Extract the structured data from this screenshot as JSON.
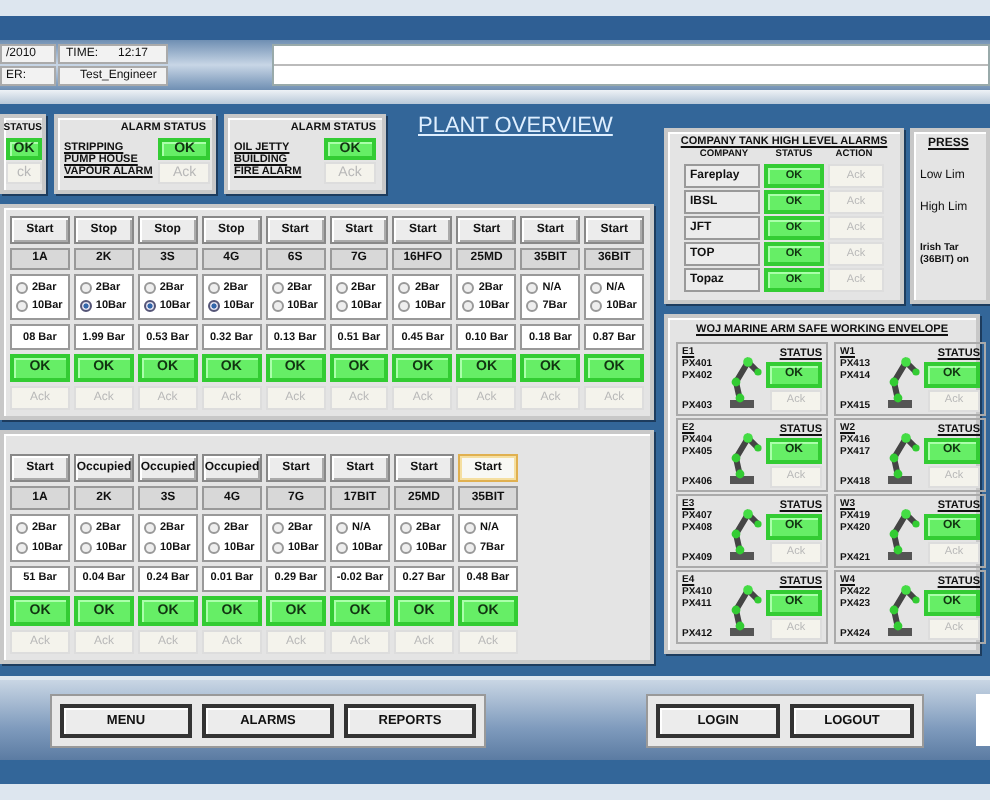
{
  "header": {
    "date": "/2010",
    "time_label": "TIME:",
    "time": "12:17",
    "user_label": "ER:",
    "user": "Test_Engineer"
  },
  "alarms": [
    {
      "heading": "STATUS",
      "status": "OK",
      "ack": "ck"
    },
    {
      "heading": "ALARM STATUS",
      "lines": [
        "STRIPPING",
        "PUMP HOUSE",
        "VAPOUR  ALARM"
      ],
      "status": "OK",
      "ack": "Ack"
    },
    {
      "heading": "ALARM STATUS",
      "lines": [
        "OIL JETTY",
        "BUILDING",
        "FIRE ALARM"
      ],
      "status": "OK",
      "ack": "Ack"
    }
  ],
  "title": "PLANT OVERVIEW",
  "pump_groups": [
    {
      "columns": [
        {
          "button": "Start",
          "focused": false,
          "name": "1A",
          "options": [
            {
              "label": "2Bar",
              "selected": false
            },
            {
              "label": "10Bar",
              "selected": false
            }
          ],
          "reading": "08 Bar",
          "status": "OK",
          "ack": "Ack"
        },
        {
          "button": "Stop",
          "focused": false,
          "name": "2K",
          "options": [
            {
              "label": "2Bar",
              "selected": false
            },
            {
              "label": "10Bar",
              "selected": true
            }
          ],
          "reading": "1.99 Bar",
          "status": "OK",
          "ack": "Ack"
        },
        {
          "button": "Stop",
          "focused": false,
          "name": "3S",
          "options": [
            {
              "label": "2Bar",
              "selected": false
            },
            {
              "label": "10Bar",
              "selected": true
            }
          ],
          "reading": "0.53 Bar",
          "status": "OK",
          "ack": "Ack"
        },
        {
          "button": "Stop",
          "focused": false,
          "name": "4G",
          "options": [
            {
              "label": "2Bar",
              "selected": false
            },
            {
              "label": "10Bar",
              "selected": true
            }
          ],
          "reading": "0.32 Bar",
          "status": "OK",
          "ack": "Ack"
        },
        {
          "button": "Start",
          "focused": false,
          "name": "6S",
          "options": [
            {
              "label": "2Bar",
              "selected": false
            },
            {
              "label": "10Bar",
              "selected": false
            }
          ],
          "reading": "0.13 Bar",
          "status": "OK",
          "ack": "Ack"
        },
        {
          "button": "Start",
          "focused": false,
          "name": "7G",
          "options": [
            {
              "label": "2Bar",
              "selected": false
            },
            {
              "label": "10Bar",
              "selected": false
            }
          ],
          "reading": "0.51 Bar",
          "status": "OK",
          "ack": "Ack"
        },
        {
          "button": "Start",
          "focused": false,
          "name": "16HFO",
          "options": [
            {
              "label": "2Bar",
              "selected": false
            },
            {
              "label": "10Bar",
              "selected": false
            }
          ],
          "reading": "0.45 Bar",
          "status": "OK",
          "ack": "Ack"
        },
        {
          "button": "Start",
          "focused": false,
          "name": "25MD",
          "options": [
            {
              "label": "2Bar",
              "selected": false
            },
            {
              "label": "10Bar",
              "selected": false
            }
          ],
          "reading": "0.10 Bar",
          "status": "OK",
          "ack": "Ack"
        },
        {
          "button": "Start",
          "focused": false,
          "name": "35BIT",
          "options": [
            {
              "label": "N/A",
              "selected": false
            },
            {
              "label": "7Bar",
              "selected": false
            }
          ],
          "reading": "0.18 Bar",
          "status": "OK",
          "ack": "Ack"
        },
        {
          "button": "Start",
          "focused": false,
          "name": "36BIT",
          "options": [
            {
              "label": "N/A",
              "selected": false
            },
            {
              "label": "10Bar",
              "selected": false
            }
          ],
          "reading": "0.87 Bar",
          "status": "OK",
          "ack": "Ack"
        }
      ]
    },
    {
      "columns": [
        {
          "button": "Start",
          "focused": false,
          "name": "1A",
          "options": [
            {
              "label": "2Bar",
              "selected": false
            },
            {
              "label": "10Bar",
              "selected": false
            }
          ],
          "reading": "51 Bar",
          "status": "OK",
          "ack": "Ack"
        },
        {
          "button": "Occupied",
          "focused": false,
          "name": "2K",
          "options": [
            {
              "label": "2Bar",
              "selected": false
            },
            {
              "label": "10Bar",
              "selected": false
            }
          ],
          "reading": "0.04 Bar",
          "status": "OK",
          "ack": "Ack"
        },
        {
          "button": "Occupied",
          "focused": false,
          "name": "3S",
          "options": [
            {
              "label": "2Bar",
              "selected": false
            },
            {
              "label": "10Bar",
              "selected": false
            }
          ],
          "reading": "0.24 Bar",
          "status": "OK",
          "ack": "Ack"
        },
        {
          "button": "Occupied",
          "focused": false,
          "name": "4G",
          "options": [
            {
              "label": "2Bar",
              "selected": false
            },
            {
              "label": "10Bar",
              "selected": false
            }
          ],
          "reading": "0.01 Bar",
          "status": "OK",
          "ack": "Ack"
        },
        {
          "button": "Start",
          "focused": false,
          "name": "7G",
          "options": [
            {
              "label": "2Bar",
              "selected": false
            },
            {
              "label": "10Bar",
              "selected": false
            }
          ],
          "reading": "0.29 Bar",
          "status": "OK",
          "ack": "Ack"
        },
        {
          "button": "Start",
          "focused": false,
          "name": "17BIT",
          "options": [
            {
              "label": "N/A",
              "selected": false
            },
            {
              "label": "10Bar",
              "selected": false
            }
          ],
          "reading": "-0.02 Bar",
          "status": "OK",
          "ack": "Ack"
        },
        {
          "button": "Start",
          "focused": false,
          "name": "25MD",
          "options": [
            {
              "label": "2Bar",
              "selected": false
            },
            {
              "label": "10Bar",
              "selected": false
            }
          ],
          "reading": "0.27 Bar",
          "status": "OK",
          "ack": "Ack"
        },
        {
          "button": "Start",
          "focused": true,
          "name": "35BIT",
          "options": [
            {
              "label": "N/A",
              "selected": false
            },
            {
              "label": "7Bar",
              "selected": false
            }
          ],
          "reading": "0.48 Bar",
          "status": "OK",
          "ack": "Ack"
        }
      ]
    }
  ],
  "tank_alarms": {
    "title": "COMPANY TANK HIGH LEVEL ALARMS",
    "columns": [
      "COMPANY",
      "STATUS",
      "ACTION"
    ],
    "rows": [
      {
        "company": "Fareplay",
        "status": "OK",
        "action": "Ack"
      },
      {
        "company": "IBSL",
        "status": "OK",
        "action": "Ack"
      },
      {
        "company": "JFT",
        "status": "OK",
        "action": "Ack"
      },
      {
        "company": "TOP",
        "status": "OK",
        "action": "Ack"
      },
      {
        "company": "Topaz",
        "status": "OK",
        "action": "Ack"
      }
    ]
  },
  "pressure": {
    "title": "PRESS",
    "low": "Low Lim",
    "high": "High Lim",
    "note": [
      "Irish Tar",
      "(36BIT) on"
    ]
  },
  "marine_arms": {
    "title": "WOJ MARINE ARM SAFE WORKING ENVELOPE",
    "arms": [
      {
        "name": "E1",
        "sensors": [
          "PX401",
          "PX402",
          "PX403"
        ],
        "status_label": "STATUS",
        "status": "OK",
        "ack": "Ack"
      },
      {
        "name": "W1",
        "sensors": [
          "PX413",
          "PX414",
          "PX415"
        ],
        "status_label": "STATUS",
        "status": "OK",
        "ack": "Ack"
      },
      {
        "name": "E2",
        "sensors": [
          "PX404",
          "PX405",
          "PX406"
        ],
        "status_label": "STATUS",
        "status": "OK",
        "ack": "Ack"
      },
      {
        "name": "W2",
        "sensors": [
          "PX416",
          "PX417",
          "PX418"
        ],
        "status_label": "STATUS",
        "status": "OK",
        "ack": "Ack"
      },
      {
        "name": "E3",
        "sensors": [
          "PX407",
          "PX408",
          "PX409"
        ],
        "status_label": "STATUS",
        "status": "OK",
        "ack": "Ack"
      },
      {
        "name": "W3",
        "sensors": [
          "PX419",
          "PX420",
          "PX421"
        ],
        "status_label": "STATUS",
        "status": "OK",
        "ack": "Ack"
      },
      {
        "name": "E4",
        "sensors": [
          "PX410",
          "PX411",
          "PX412"
        ],
        "status_label": "STATUS",
        "status": "OK",
        "ack": "Ack"
      },
      {
        "name": "W4",
        "sensors": [
          "PX422",
          "PX423",
          "PX424"
        ],
        "status_label": "STATUS",
        "status": "OK",
        "ack": "Ack"
      }
    ]
  },
  "nav": {
    "left": [
      "MENU",
      "ALARMS",
      "REPORTS"
    ],
    "right": [
      "LOGIN",
      "LOGOUT"
    ]
  }
}
